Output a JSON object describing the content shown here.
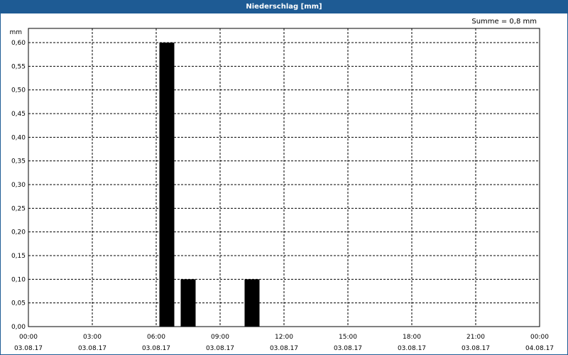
{
  "window": {
    "title": "Niederschlag [mm]"
  },
  "summary": "Summe = 0,8 mm",
  "colors": {
    "title_bar": "#1e5b94",
    "bars": "#000000",
    "grid": "#000000"
  },
  "chart_data": {
    "type": "bar",
    "title": "Niederschlag [mm]",
    "ylabel": "mm",
    "ylim": [
      0,
      0.6
    ],
    "y_ticks": [
      "0,00",
      "0,05",
      "0,10",
      "0,15",
      "0,20",
      "0,25",
      "0,30",
      "0,35",
      "0,40",
      "0,45",
      "0,50",
      "0,55",
      "0,60"
    ],
    "xlim_hours": [
      0,
      24
    ],
    "x_ticks": [
      {
        "time": "00:00",
        "date": "03.08.17"
      },
      {
        "time": "03:00",
        "date": "03.08.17"
      },
      {
        "time": "06:00",
        "date": "03.08.17"
      },
      {
        "time": "09:00",
        "date": "03.08.17"
      },
      {
        "time": "12:00",
        "date": "03.08.17"
      },
      {
        "time": "15:00",
        "date": "03.08.17"
      },
      {
        "time": "18:00",
        "date": "03.08.17"
      },
      {
        "time": "21:00",
        "date": "03.08.17"
      },
      {
        "time": "00:00",
        "date": "04.08.17"
      }
    ],
    "bars": [
      {
        "start": "03.08.17 06:00",
        "end": "03.08.17 07:00",
        "value": 0.6
      },
      {
        "start": "03.08.17 07:00",
        "end": "03.08.17 08:00",
        "value": 0.1
      },
      {
        "start": "03.08.17 10:00",
        "end": "03.08.17 11:00",
        "value": 0.1
      }
    ],
    "grid": true,
    "grid_style": "dashed"
  }
}
